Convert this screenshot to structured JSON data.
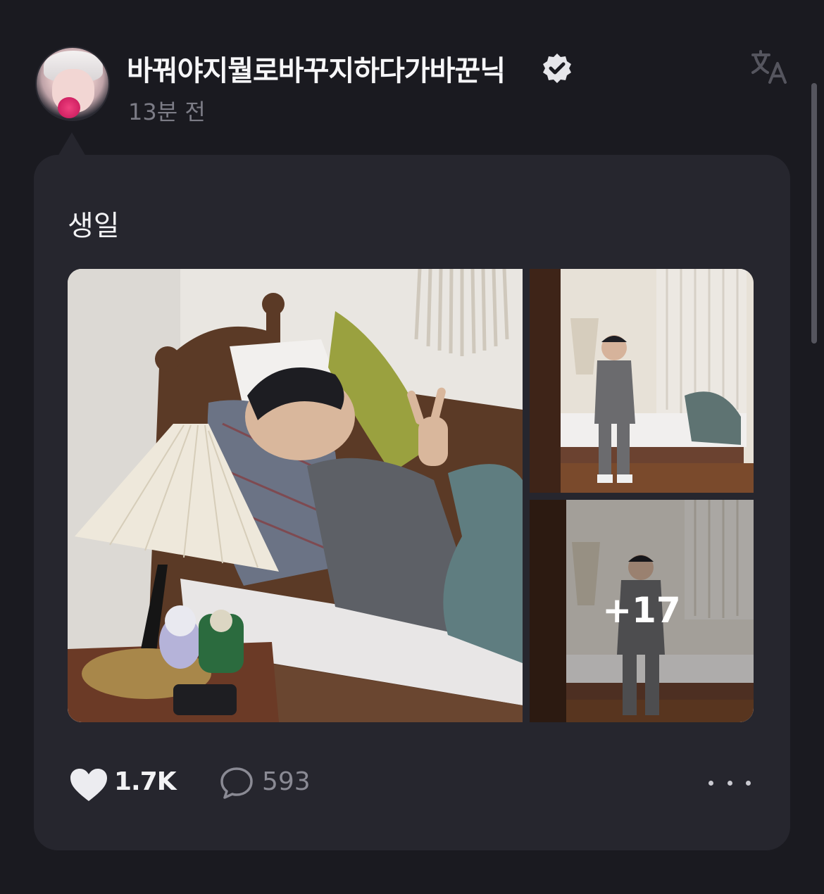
{
  "post": {
    "author": {
      "name": "바꿔야지뭘로바꾸지하다가바꾼닉",
      "verified": true,
      "avatar_icon": "profile-photo"
    },
    "time_ago": "13분 전",
    "text": "생일",
    "images": {
      "shown": 3,
      "more_overlay": "+17"
    },
    "stats": {
      "likes": "1.7K",
      "comments": "593"
    }
  },
  "icons": {
    "translate": "translate-icon",
    "verified": "verified-badge-icon",
    "like": "heart-icon",
    "comment": "comment-bubble-icon",
    "more": "more-options-icon"
  },
  "colors": {
    "background": "#1a1a20",
    "card": "#26262e",
    "muted_text": "#7c7c86",
    "primary_text": "#f2f2f4"
  }
}
